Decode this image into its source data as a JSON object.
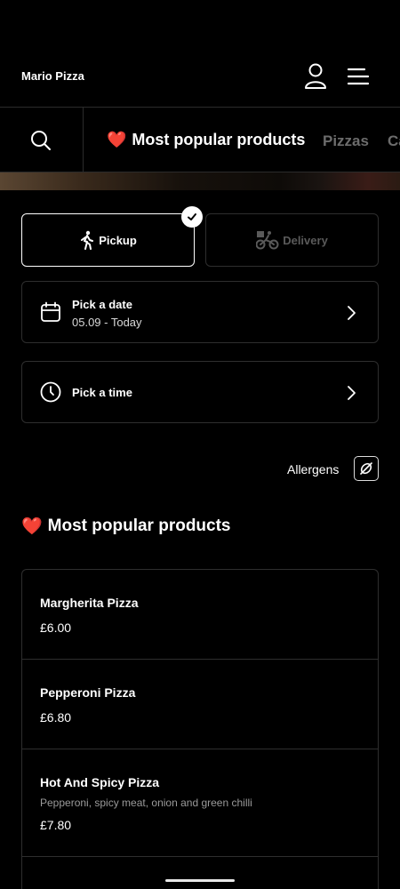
{
  "header": {
    "brand": "Mario Pizza",
    "user_icon": "user-icon",
    "menu_icon": "hamburger-menu-icon"
  },
  "categories": {
    "search_icon": "search-icon",
    "items": [
      {
        "label": "Most popular products",
        "emoji": "❤️",
        "active": true
      },
      {
        "label": "Pizzas",
        "active": false
      },
      {
        "label": "Ca",
        "active": false
      }
    ]
  },
  "order_mode": {
    "pickup": {
      "label": "Pickup",
      "icon": "walking-person-icon",
      "selected": true
    },
    "delivery": {
      "label": "Delivery",
      "icon": "bike-courier-icon",
      "selected": false
    }
  },
  "date": {
    "label": "Pick a date",
    "value": "05.09 - Today",
    "icon": "calendar-icon"
  },
  "time": {
    "label": "Pick a time",
    "icon": "clock-icon"
  },
  "allergens": {
    "label": "Allergens",
    "icon": "no-allergens-icon"
  },
  "section": {
    "emoji": "❤️",
    "title": "Most popular products"
  },
  "products": [
    {
      "name": "Margherita Pizza",
      "description": "",
      "price": "£6.00"
    },
    {
      "name": "Pepperoni Pizza",
      "description": "",
      "price": "£6.80"
    },
    {
      "name": "Hot And Spicy Pizza",
      "description": "Pepperoni, spicy meat, onion and green chilli",
      "price": "£7.80"
    }
  ],
  "colors": {
    "background": "#000000",
    "text": "#ffffff",
    "muted": "#6c6c6c",
    "border": "#2e2e2e"
  }
}
